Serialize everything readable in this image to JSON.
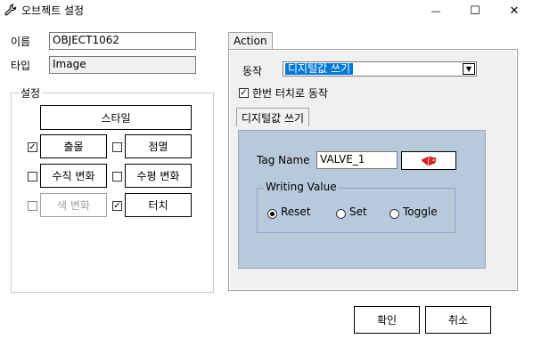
{
  "window": {
    "title": "오브젝트 설정",
    "minimize_glyph": "—",
    "maximize_glyph": "☐",
    "close_glyph": "✕",
    "icon": "wrench-icon"
  },
  "fields": {
    "name_label": "이름",
    "name_value": "OBJECT1062",
    "type_label": "타입",
    "type_value": "Image"
  },
  "settings": {
    "group_title": "설정",
    "style_button": "스타일",
    "appear": {
      "label": "출몰",
      "checked": "✓"
    },
    "blink": {
      "label": "점멸",
      "checked": ""
    },
    "vertical_change": {
      "label": "수직 변화",
      "checked": ""
    },
    "horizontal_change": {
      "label": "수평 변화",
      "checked": ""
    },
    "color_change": {
      "label": "색 변화",
      "checked": ""
    },
    "touch": {
      "label": "터치",
      "checked": "✓"
    }
  },
  "action": {
    "tab_label": "Action",
    "action_label": "동작",
    "action_value": "디지털값 쓰기",
    "single_touch": {
      "label": "한번 터치로 동작",
      "checked": "✓"
    },
    "subtab_label": "디지털값 쓰기",
    "tag_name_label": "Tag Name",
    "tag_name_value": "VALVE_1",
    "tag_browse_icon": "tag-browse-icon",
    "writing_value_title": "Writing Value",
    "radios": [
      {
        "label": "Reset",
        "selected": true
      },
      {
        "label": "Set",
        "selected": false
      },
      {
        "label": "Toggle",
        "selected": false
      }
    ]
  },
  "footer": {
    "ok_label": "확인",
    "cancel_label": "취소"
  }
}
